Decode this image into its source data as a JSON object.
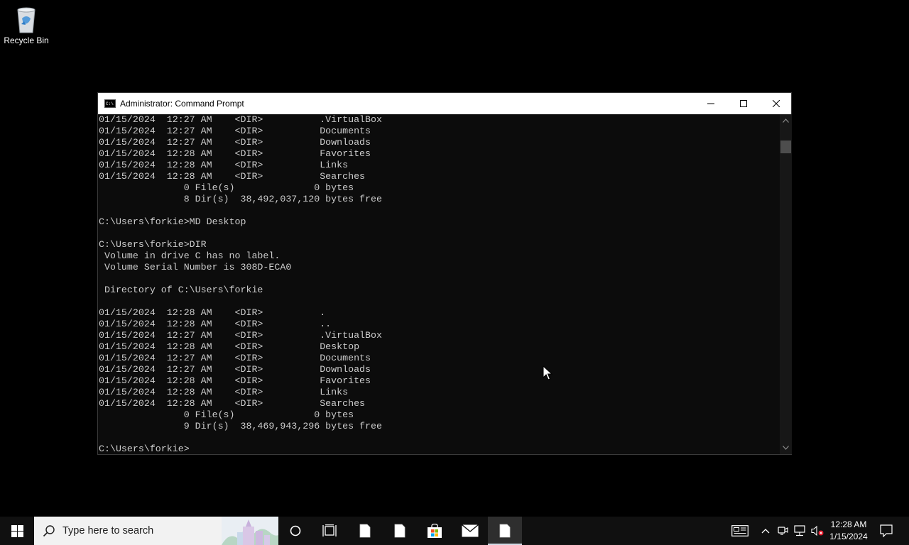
{
  "desktop": {
    "icons": [
      {
        "label": "Recycle Bin",
        "icon": "recycle-bin-icon"
      }
    ]
  },
  "window": {
    "title": "Administrator: Command Prompt",
    "minimize_icon": "minimize-icon",
    "maximize_icon": "maximize-icon",
    "close_icon": "close-icon"
  },
  "console": {
    "lines": [
      "01/15/2024  12:27 AM    <DIR>          .VirtualBox",
      "01/15/2024  12:27 AM    <DIR>          Documents",
      "01/15/2024  12:27 AM    <DIR>          Downloads",
      "01/15/2024  12:28 AM    <DIR>          Favorites",
      "01/15/2024  12:28 AM    <DIR>          Links",
      "01/15/2024  12:28 AM    <DIR>          Searches",
      "               0 File(s)              0 bytes",
      "               8 Dir(s)  38,492,037,120 bytes free",
      "",
      "C:\\Users\\forkie>MD Desktop",
      "",
      "C:\\Users\\forkie>DIR",
      " Volume in drive C has no label.",
      " Volume Serial Number is 308D-ECA0",
      "",
      " Directory of C:\\Users\\forkie",
      "",
      "01/15/2024  12:28 AM    <DIR>          .",
      "01/15/2024  12:28 AM    <DIR>          ..",
      "01/15/2024  12:27 AM    <DIR>          .VirtualBox",
      "01/15/2024  12:28 AM    <DIR>          Desktop",
      "01/15/2024  12:27 AM    <DIR>          Documents",
      "01/15/2024  12:27 AM    <DIR>          Downloads",
      "01/15/2024  12:28 AM    <DIR>          Favorites",
      "01/15/2024  12:28 AM    <DIR>          Links",
      "01/15/2024  12:28 AM    <DIR>          Searches",
      "               0 File(s)              0 bytes",
      "               9 Dir(s)  38,469,943,296 bytes free",
      "",
      "C:\\Users\\forkie>"
    ],
    "text_color": "#cccccc",
    "background": "#0c0c0c"
  },
  "taskbar": {
    "search_placeholder": "Type here to search",
    "start_icon": "windows-logo-icon",
    "items": [
      {
        "name": "cortana-icon"
      },
      {
        "name": "task-view-icon"
      },
      {
        "name": "file-icon"
      },
      {
        "name": "file-icon"
      },
      {
        "name": "store-icon"
      },
      {
        "name": "mail-icon"
      },
      {
        "name": "file-icon",
        "active": true
      }
    ],
    "tray": {
      "time": "12:28 AM",
      "date": "1/15/2024",
      "icons": [
        "news-icon",
        "chevron-up-icon",
        "meet-icon",
        "network-icon",
        "volume-muted-icon",
        "notification-icon"
      ]
    }
  }
}
